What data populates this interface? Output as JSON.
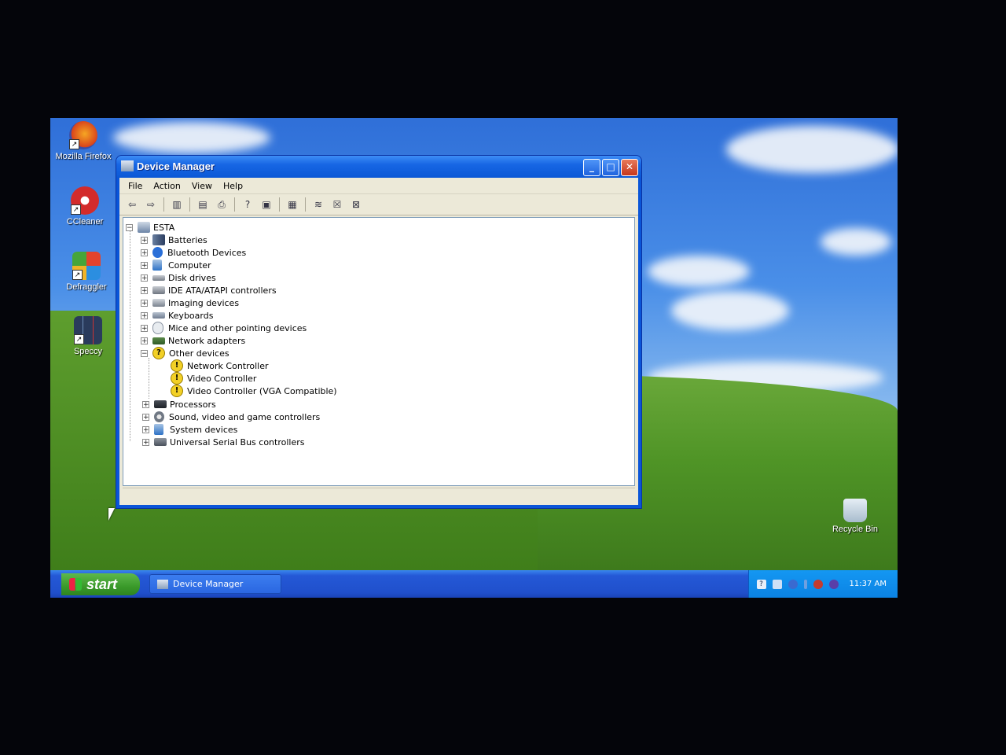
{
  "desktop": {
    "icons": [
      {
        "label": "Mozilla Firefox",
        "icon": "firefox-icon"
      },
      {
        "label": "CCleaner",
        "icon": "ccleaner-icon"
      },
      {
        "label": "Defraggler",
        "icon": "defraggler-icon"
      },
      {
        "label": "Speccy",
        "icon": "speccy-icon"
      }
    ],
    "recycle_bin": {
      "label": "Recycle Bin",
      "icon": "recycle-bin-icon"
    }
  },
  "window": {
    "title": "Device Manager",
    "controls": {
      "minimize": "_",
      "maximize": "□",
      "close": "✕"
    },
    "menu": [
      "File",
      "Action",
      "View",
      "Help"
    ],
    "toolbar_icons": [
      "back-icon",
      "forward-icon",
      "show-hide-tree-icon",
      "properties-icon",
      "print-icon",
      "help-icon",
      "view-icon",
      "scan-hardware-icon",
      "update-driver-icon",
      "uninstall-icon",
      "disable-icon"
    ],
    "tree": {
      "root": "ESTA",
      "categories": [
        {
          "label": "Batteries",
          "expanded": false
        },
        {
          "label": "Bluetooth Devices",
          "expanded": false
        },
        {
          "label": "Computer",
          "expanded": false
        },
        {
          "label": "Disk drives",
          "expanded": false
        },
        {
          "label": "IDE ATA/ATAPI controllers",
          "expanded": false
        },
        {
          "label": "Imaging devices",
          "expanded": false
        },
        {
          "label": "Keyboards",
          "expanded": false
        },
        {
          "label": "Mice and other pointing devices",
          "expanded": false
        },
        {
          "label": "Network adapters",
          "expanded": false
        },
        {
          "label": "Other devices",
          "expanded": true
        },
        {
          "label": "Processors",
          "expanded": false
        },
        {
          "label": "Sound, video and game controllers",
          "expanded": false
        },
        {
          "label": "System devices",
          "expanded": false
        },
        {
          "label": "Universal Serial Bus controllers",
          "expanded": false
        }
      ],
      "other_devices_children": [
        "Network Controller",
        "Video Controller",
        "Video Controller (VGA Compatible)"
      ]
    }
  },
  "taskbar": {
    "start_label": "start",
    "task_button_label": "Device Manager",
    "clock": "11:37 AM"
  },
  "colors": {
    "titlebar": "#0b58d6",
    "taskbar": "#2458d6",
    "start_button": "#3a9a2a",
    "warning": "#f2d026"
  }
}
